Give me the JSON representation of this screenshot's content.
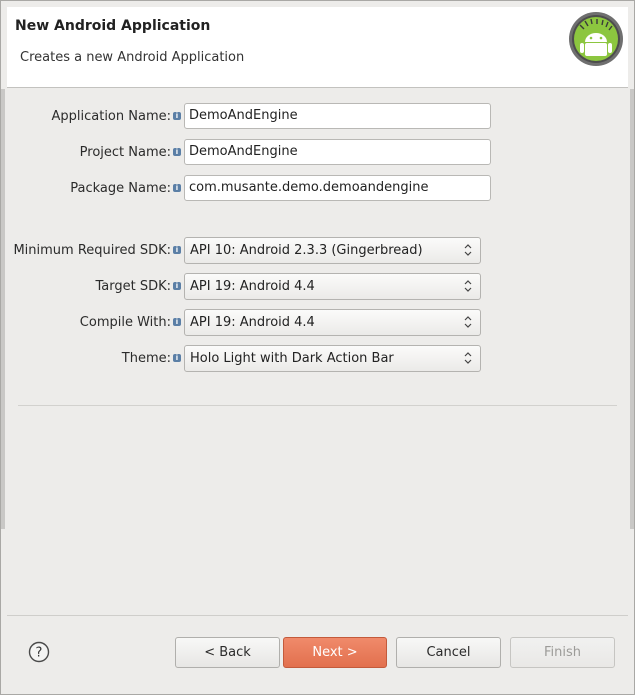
{
  "header": {
    "title": "New Android Application",
    "subtitle": "Creates a new Android Application"
  },
  "form": {
    "application_name": {
      "label": "Application Name:",
      "value": "DemoAndEngine"
    },
    "project_name": {
      "label": "Project Name:",
      "value": "DemoAndEngine"
    },
    "package_name": {
      "label": "Package Name:",
      "value": "com.musante.demo.demoandengine"
    },
    "min_sdk": {
      "label": "Minimum Required SDK:",
      "value": "API 10: Android 2.3.3 (Gingerbread)"
    },
    "target_sdk": {
      "label": "Target SDK:",
      "value": "API 19: Android 4.4"
    },
    "compile_with": {
      "label": "Compile With:",
      "value": "API 19: Android 4.4"
    },
    "theme": {
      "label": "Theme:",
      "value": "Holo Light with Dark Action Bar"
    }
  },
  "buttons": {
    "back": "< Back",
    "next": "Next >",
    "cancel": "Cancel",
    "finish": "Finish",
    "help": "?"
  },
  "icons": {
    "logo": "android-logo-icon",
    "info": "info-icon",
    "help": "help-icon",
    "arrows": "select-arrows-icon"
  },
  "colors": {
    "primary_button": "#e2704e",
    "android_green": "#8cc63f",
    "info": "#5b7fa6"
  }
}
